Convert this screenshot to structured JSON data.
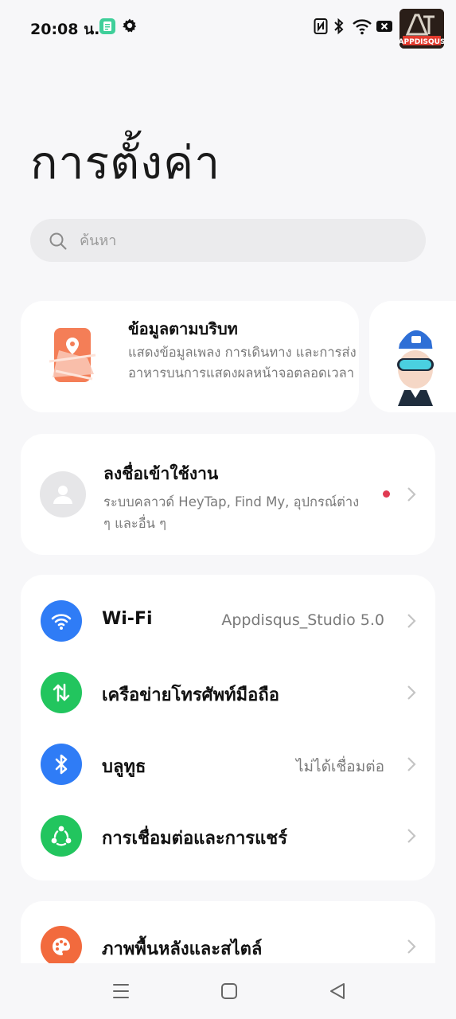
{
  "status_bar": {
    "time": "20:08 น.",
    "icons": [
      "app-notification-icon",
      "gear-icon",
      "nfc-icon",
      "bluetooth-icon",
      "wifi-icon",
      "battery-icon"
    ]
  },
  "logo": {
    "text": "APPDISQUS"
  },
  "page": {
    "title": "การตั้งค่า"
  },
  "search": {
    "placeholder": "ค้นหา"
  },
  "context_card": {
    "title": "ข้อมูลตามบริบท",
    "description": "แสดงข้อมูลเพลง การเดินทาง และการส่งอาหารบนการแสดงผลหน้าจอตลอดเวลา",
    "icon": "location-map-icon"
  },
  "account": {
    "title": "ลงชื่อเข้าใช้งาน",
    "description": "ระบบคลาวด์ HeyTap, Find My, อุปกรณ์ต่าง ๆ และอื่น ๆ",
    "has_notification_dot": true
  },
  "connectivity": [
    {
      "label": "Wi-Fi",
      "value": "Appdisqus_Studio 5.0",
      "icon": "wifi-icon",
      "color": "#2f7cf6"
    },
    {
      "label": "เครือข่ายโทรศัพท์มือถือ",
      "value": "",
      "icon": "mobile-data-icon",
      "color": "#22c55e"
    },
    {
      "label": "บลูทูธ",
      "value": "ไม่ได้เชื่อมต่อ",
      "icon": "bluetooth-icon",
      "color": "#2f7cf6"
    },
    {
      "label": "การเชื่อมต่อและการแชร์",
      "value": "",
      "icon": "share-icon",
      "color": "#22c55e"
    }
  ],
  "style_row": {
    "label": "ภาพพื้นหลังและสไตล์",
    "icon": "palette-icon",
    "color": "#f26a3d"
  },
  "colors": {
    "background": "#f7f7f9",
    "card": "#ffffff",
    "accent_blue": "#2f7cf6",
    "accent_green": "#22c55e",
    "accent_orange": "#f26a3d",
    "dot_red": "#e03a52"
  },
  "nav": [
    "menu-icon",
    "home-icon",
    "back-icon"
  ]
}
